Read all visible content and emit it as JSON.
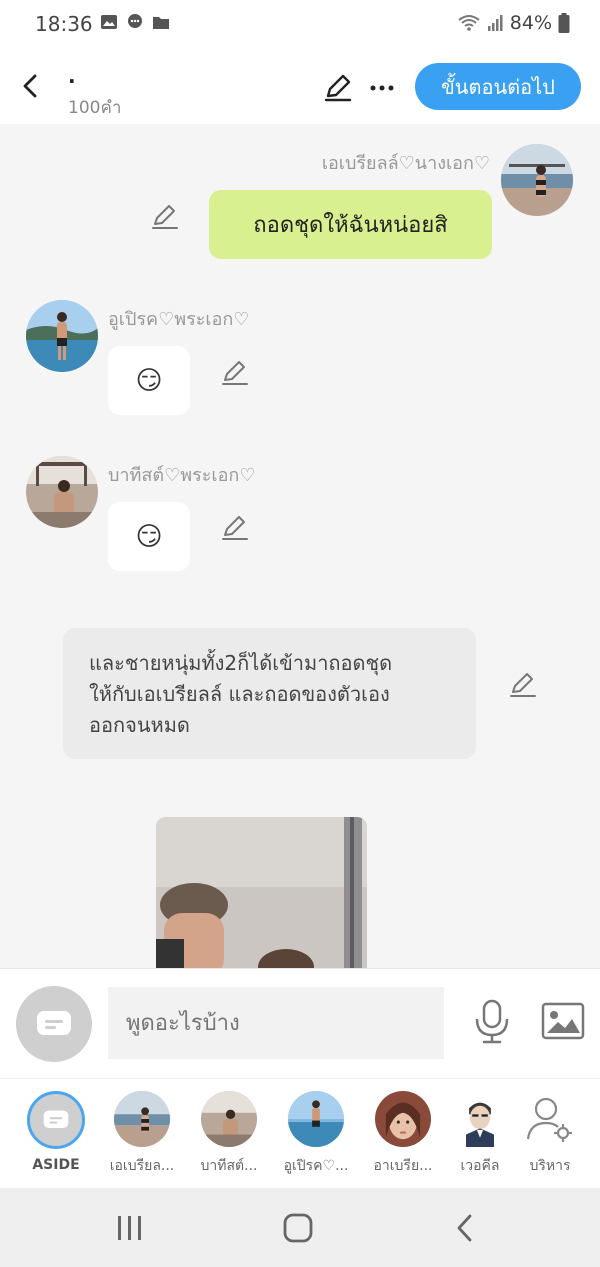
{
  "status_bar": {
    "time": "18:36",
    "battery": "84%"
  },
  "header": {
    "title": ".",
    "word_count": "100คำ",
    "next_label": "ขั้นตอนต่อไป"
  },
  "messages": [
    {
      "speaker": "เอเบรียลล์♡นางเอก♡",
      "text": "ถอดชุดให้ฉันหน่อยสิ",
      "side": "right"
    },
    {
      "speaker": "อูเปิรค♡พระเอก♡",
      "text": "😏",
      "side": "left"
    },
    {
      "speaker": "บาทีสต์♡พระเอก♡",
      "text": "😏",
      "side": "left"
    },
    {
      "speaker": "",
      "text_lines": [
        "และชายหนุ่มทั้ง2ก็ได้เข้ามาถอดชุด",
        "ให้กับเอเบรียลล์ และถอดของตัวเอง",
        "ออกจนหมด"
      ],
      "side": "narration"
    }
  ],
  "input": {
    "placeholder": "พูดอะไรบ้าง"
  },
  "characters": [
    {
      "label": "ASIDE"
    },
    {
      "label": "เอเบรียล..."
    },
    {
      "label": "บาทีสต์..."
    },
    {
      "label": "อูเปิรค♡..."
    },
    {
      "label": "อาเบรีย..."
    },
    {
      "label": "เวอคีล"
    },
    {
      "label": "บริหาร"
    }
  ],
  "colors": {
    "accent": "#3aa0f2",
    "user_bubble": "#d8f08f",
    "narration_bubble": "#ebebeb"
  }
}
